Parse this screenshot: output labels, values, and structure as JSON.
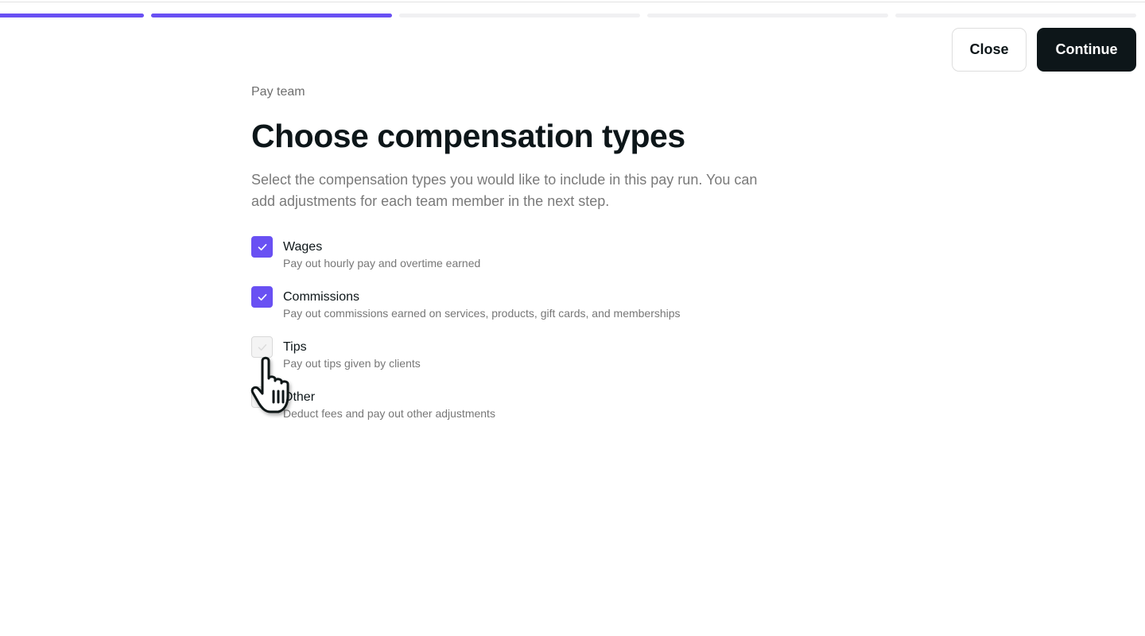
{
  "progress": {
    "steps": [
      {
        "state": "done"
      },
      {
        "state": "done"
      },
      {
        "state": "todo"
      },
      {
        "state": "todo"
      },
      {
        "state": "todo"
      }
    ],
    "accent_color": "#6950f3"
  },
  "header": {
    "close_label": "Close",
    "continue_label": "Continue"
  },
  "page": {
    "breadcrumb": "Pay team",
    "title": "Choose compensation types",
    "subtitle": "Select the compensation types you would like to include in this pay run. You can add adjustments for each team member in the next step."
  },
  "options": [
    {
      "label": "Wages",
      "description": "Pay out hourly pay and overtime earned",
      "checked": true
    },
    {
      "label": "Commissions",
      "description": "Pay out commissions earned on services, products, gift cards, and memberships",
      "checked": true
    },
    {
      "label": "Tips",
      "description": "Pay out tips given by clients",
      "checked": false
    },
    {
      "label": "Other",
      "description": "Deduct fees and pay out other adjustments",
      "checked": false
    }
  ],
  "icons": {
    "check": "check-icon",
    "cursor": "hand-pointer-cursor-icon"
  }
}
